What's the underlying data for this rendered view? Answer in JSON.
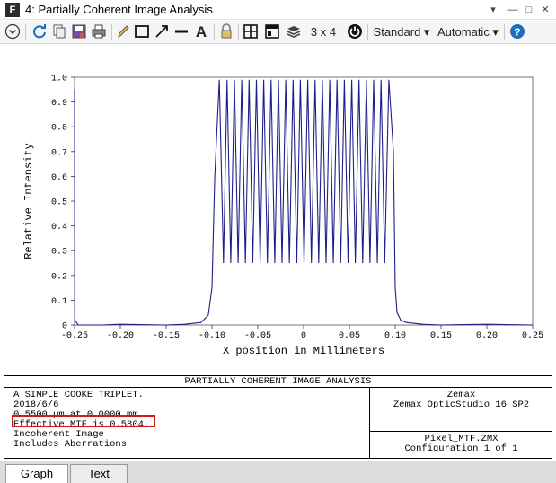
{
  "window": {
    "title": "4: Partially Coherent Image Analysis",
    "app_icon": "F"
  },
  "toolbar": {
    "layout_label": "3 x 4 ▾",
    "standard_label": "Standard ▾",
    "automatic_label": "Automatic ▾",
    "text_tool_label": "A"
  },
  "chart_data": {
    "type": "line",
    "title": "",
    "xlabel": "X position in Millimeters",
    "ylabel": "Relative Intensity",
    "xlim": [
      -0.25,
      0.25
    ],
    "ylim": [
      0,
      1.0
    ],
    "x_ticks": [
      "-0.25",
      "-0.20",
      "-0.15",
      "-0.10",
      "-0.05",
      "0",
      "0.05",
      "0.10",
      "0.15",
      "0.20",
      "0.25"
    ],
    "y_ticks": [
      "0",
      "0.1",
      "0.2",
      "0.3",
      "0.4",
      "0.5",
      "0.6",
      "0.7",
      "0.8",
      "0.9",
      "1.0"
    ],
    "grid": false,
    "line_color": "#1f1f8a",
    "series": [
      {
        "x": [
          -0.25,
          -0.2497,
          -0.246,
          -0.22,
          -0.2,
          -0.15,
          -0.13,
          -0.112,
          -0.104,
          -0.1,
          -0.097,
          -0.092,
          -0.0875,
          -0.0835,
          -0.0795,
          -0.0755,
          -0.0715,
          -0.0675,
          -0.0635,
          -0.0595,
          -0.0555,
          -0.0515,
          -0.0475,
          -0.0435,
          -0.0395,
          -0.0355,
          -0.0315,
          -0.0275,
          -0.0235,
          -0.0195,
          -0.0155,
          -0.0115,
          -0.0075,
          -0.0035,
          0.0005,
          0.0045,
          0.0085,
          0.0125,
          0.0165,
          0.0205,
          0.0245,
          0.0285,
          0.0325,
          0.0365,
          0.0405,
          0.0445,
          0.0485,
          0.0525,
          0.0565,
          0.0605,
          0.0645,
          0.0685,
          0.0725,
          0.0765,
          0.0805,
          0.0845,
          0.0885,
          0.093,
          0.098,
          0.1,
          0.102,
          0.106,
          0.112,
          0.13,
          0.15,
          0.2,
          0.25
        ],
        "y": [
          0.95,
          0.02,
          0.0,
          0.0,
          0.003,
          0.0,
          0.003,
          0.01,
          0.04,
          0.15,
          0.6,
          0.99,
          0.25,
          0.99,
          0.25,
          0.99,
          0.25,
          0.99,
          0.25,
          0.99,
          0.25,
          0.99,
          0.25,
          0.99,
          0.25,
          0.99,
          0.25,
          0.99,
          0.25,
          0.99,
          0.25,
          0.99,
          0.25,
          0.99,
          0.25,
          0.99,
          0.25,
          0.99,
          0.25,
          0.99,
          0.25,
          0.99,
          0.25,
          0.99,
          0.25,
          0.99,
          0.25,
          0.99,
          0.25,
          0.99,
          0.25,
          0.99,
          0.25,
          0.99,
          0.25,
          0.99,
          0.25,
          0.99,
          0.7,
          0.15,
          0.05,
          0.02,
          0.01,
          0.003,
          0.0,
          0.003,
          0.0
        ]
      }
    ]
  },
  "info_panel": {
    "title": "PARTIALLY COHERENT IMAGE ANALYSIS",
    "lines": [
      "A SIMPLE COOKE TRIPLET.",
      "2018/6/6",
      "0.5500 µm at 0.0000 mm.",
      "Effective MTF is 0.5804.",
      "Incoherent Image",
      "Includes Aberrations"
    ],
    "company": "Zemax",
    "product": "Zemax OpticStudio 16 SP2",
    "file": "Pixel_MTF.ZMX",
    "configuration": "Configuration 1 of 1"
  },
  "tabs": [
    {
      "label": "Graph",
      "active": true
    },
    {
      "label": "Text",
      "active": false
    }
  ],
  "colors": {
    "highlight_box": "#d11a1a",
    "plot_line": "#1f1f8a",
    "help_icon": "#1a6fc4"
  }
}
